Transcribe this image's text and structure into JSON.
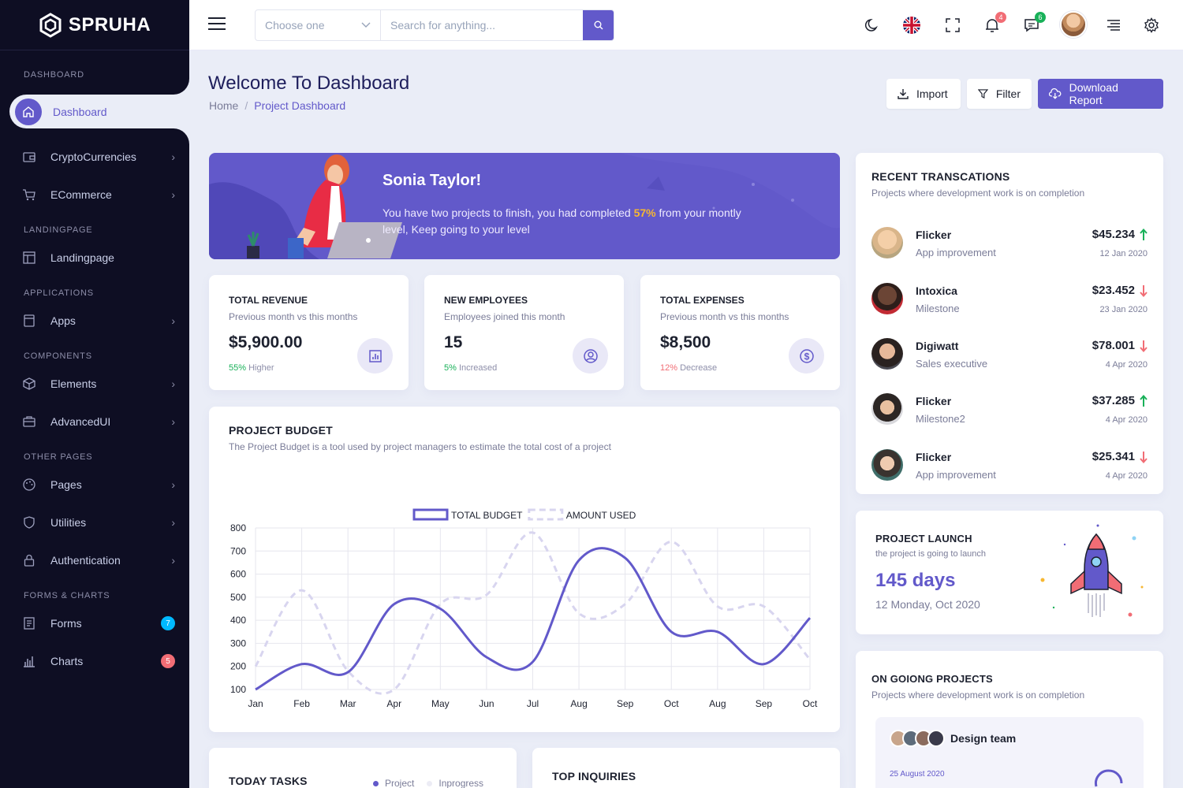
{
  "app": {
    "logo_text": "SPRUHA"
  },
  "sidebar": {
    "active": {
      "label": "Dashboard"
    },
    "categories": {
      "dashboard": "DASHBOARD",
      "landing": "LANDINGPAGE",
      "applications": "APPLICATIONS",
      "components": "COMPONENTS",
      "other": "OTHER PAGES",
      "forms": "FORMS & CHARTS"
    },
    "items": [
      {
        "label": "CryptoCurrencies"
      },
      {
        "label": "ECommerce"
      },
      {
        "label": "Landingpage"
      },
      {
        "label": "Apps"
      },
      {
        "label": "Elements"
      },
      {
        "label": "AdvancedUI"
      },
      {
        "label": "Pages"
      },
      {
        "label": "Utilities"
      },
      {
        "label": "Authentication"
      },
      {
        "label": "Forms",
        "badge": "7"
      },
      {
        "label": "Charts",
        "badge": "5"
      }
    ]
  },
  "header": {
    "select_placeholder": "Choose one",
    "search_placeholder": "Search for anything...",
    "notifications_count": "4",
    "messages_count": "6"
  },
  "page": {
    "title": "Welcome To Dashboard",
    "breadcrumb_home": "Home",
    "breadcrumb_sep": "/",
    "breadcrumb_current": "Project Dashboard",
    "btn_import": "Import",
    "btn_filter": "Filter",
    "btn_download": "Download Report"
  },
  "banner": {
    "name": "Sonia Taylor!",
    "text_before": "You have two projects to finish, you had completed ",
    "percent": "57%",
    "text_after": " from your montly level, Keep going to your level"
  },
  "stats": [
    {
      "title": "TOTAL REVENUE",
      "sub": "Previous month vs this months",
      "value": "$5,900.00",
      "change": "55%",
      "change_label": " Higher",
      "change_color": "#19b159"
    },
    {
      "title": "NEW EMPLOYEES",
      "sub": "Employees joined this month",
      "value": "15",
      "change": "5%",
      "change_label": " Increased",
      "change_color": "#19b159"
    },
    {
      "title": "TOTAL EXPENSES",
      "sub": "Previous month vs this months",
      "value": "$8,500",
      "change": "12%",
      "change_label": " Decrease",
      "change_color": "#f16d75"
    }
  ],
  "budget": {
    "title": "PROJECT BUDGET",
    "sub": "The Project Budget is a tool used by project managers to estimate the total cost of a project"
  },
  "chart_data": {
    "type": "line",
    "categories": [
      "Jan",
      "Feb",
      "Mar",
      "Apr",
      "May",
      "Jun",
      "Jul",
      "Aug",
      "Sep",
      "Oct",
      "Aug",
      "Sep",
      "Oct"
    ],
    "ylim": [
      100,
      800
    ],
    "yticks": [
      100,
      200,
      300,
      400,
      500,
      600,
      700,
      800
    ],
    "grid": true,
    "legend_position": "top-center",
    "series": [
      {
        "name": "TOTAL BUDGET",
        "color": "#6259ca",
        "style": "solid",
        "values": [
          100,
          210,
          175,
          470,
          450,
          240,
          220,
          660,
          670,
          350,
          350,
          210,
          410
        ]
      },
      {
        "name": "AMOUNT USED",
        "color": "#d8d5ef",
        "style": "dashed",
        "values": [
          200,
          530,
          180,
          100,
          470,
          510,
          780,
          430,
          470,
          740,
          460,
          460,
          230
        ]
      }
    ]
  },
  "transactions": {
    "title": "RECENT TRANSCATIONS",
    "sub": "Projects where development work is on completion",
    "items": [
      {
        "name": "Flicker",
        "desc": "App improvement",
        "amount": "$45.234",
        "trend": "up",
        "date": "12 Jan 2020"
      },
      {
        "name": "Intoxica",
        "desc": "Milestone",
        "amount": "$23.452",
        "trend": "down",
        "date": "23 Jan 2020"
      },
      {
        "name": "Digiwatt",
        "desc": "Sales executive",
        "amount": "$78.001",
        "trend": "down",
        "date": "4 Apr 2020"
      },
      {
        "name": "Flicker",
        "desc": "Milestone2",
        "amount": "$37.285",
        "trend": "up",
        "date": "4 Apr 2020"
      },
      {
        "name": "Flicker",
        "desc": "App improvement",
        "amount": "$25.341",
        "trend": "down",
        "date": "4 Apr 2020"
      }
    ]
  },
  "launch": {
    "title": "PROJECT LAUNCH",
    "sub": "the project is going to launch",
    "days": "145 days",
    "date": "12 Monday, Oct 2020"
  },
  "ongoing": {
    "title": "ON GOIONG PROJECTS",
    "sub": "Projects where development work is on completion",
    "team": "Design team",
    "date": "25 August 2020"
  },
  "tasks": {
    "title": "TODAY TASKS",
    "legend_project": "Project",
    "legend_inprogress": "Inprogress"
  },
  "inquiries": {
    "title": "TOP INQUIRIES"
  },
  "colors": {
    "primary": "#6259ca",
    "success": "#19b159",
    "danger": "#f16d75",
    "sidebar": "#0e0e23"
  }
}
